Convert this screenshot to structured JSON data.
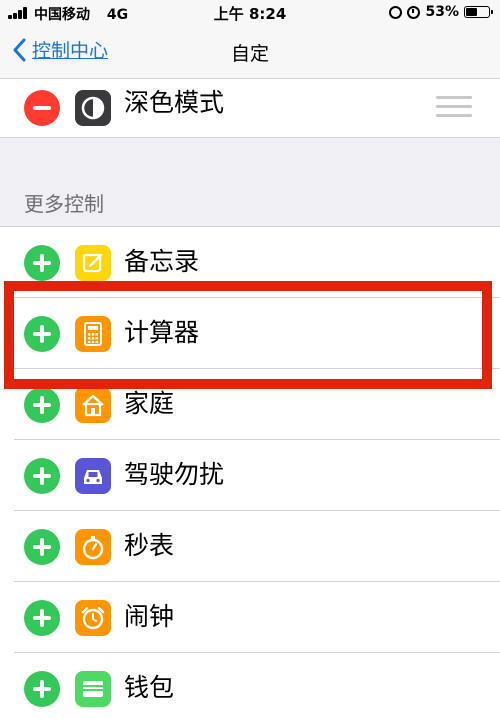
{
  "status_bar": {
    "carrier": "中国移动",
    "network": "4G",
    "time": "上午 8:24",
    "battery_percent": "53%",
    "battery_level": 0.53,
    "icons": [
      "signal-icon",
      "orientation-lock-icon",
      "alarm-icon",
      "battery-icon"
    ]
  },
  "nav": {
    "back_label": "控制中心",
    "title": "自定"
  },
  "included": {
    "items": [
      {
        "label": "深色模式",
        "icon": "dark-mode-icon",
        "color": "#3a3a3c"
      }
    ]
  },
  "more": {
    "header": "更多控制",
    "items": [
      {
        "label": "备忘录",
        "icon": "notes-icon",
        "color": "#ffd60a"
      },
      {
        "label": "计算器",
        "icon": "calculator-icon",
        "color": "#ff9500"
      },
      {
        "label": "家庭",
        "icon": "home-icon",
        "color": "#ff9500"
      },
      {
        "label": "驾驶勿扰",
        "icon": "car-icon",
        "color": "#5856d6"
      },
      {
        "label": "秒表",
        "icon": "stopwatch-icon",
        "color": "#ff9500"
      },
      {
        "label": "闹钟",
        "icon": "alarm-clock-icon",
        "color": "#ff9500"
      },
      {
        "label": "钱包",
        "icon": "wallet-icon",
        "color": "#4cd964"
      }
    ]
  },
  "colors": {
    "add_button": "#34c759",
    "remove_button": "#ff3b30",
    "back_link": "#1a73e8",
    "highlight_box": "#e3220c"
  }
}
